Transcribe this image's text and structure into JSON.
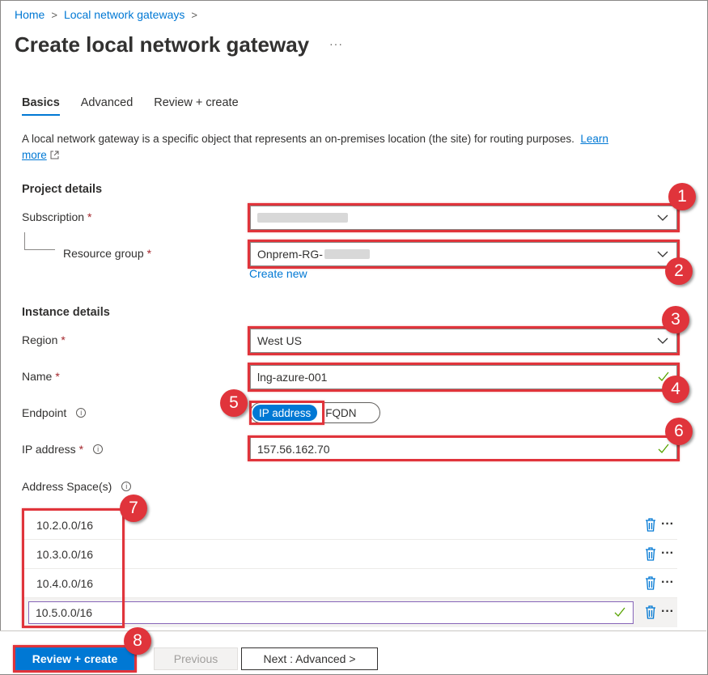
{
  "breadcrumb": {
    "home": "Home",
    "parent": "Local network gateways",
    "sep": ">"
  },
  "page_title": "Create local network gateway",
  "more_label": "···",
  "tabs": [
    {
      "label": "Basics",
      "active": true
    },
    {
      "label": "Advanced",
      "active": false
    },
    {
      "label": "Review + create",
      "active": false
    }
  ],
  "description": {
    "text": "A local network gateway is a specific object that represents an on-premises location (the site) for routing purposes.",
    "learn_more_1": "Learn",
    "learn_more_2": "more"
  },
  "project_details": {
    "heading": "Project details",
    "subscription_label": "Subscription",
    "resource_group_label": "Resource group",
    "resource_group_value": "Onprem-RG-",
    "create_new": "Create new"
  },
  "instance_details": {
    "heading": "Instance details",
    "region_label": "Region",
    "region_value": "West US",
    "name_label": "Name",
    "name_value": "lng-azure-001",
    "endpoint_label": "Endpoint",
    "endpoint_options": [
      "IP address",
      "FQDN"
    ],
    "endpoint_selected": "IP address",
    "ip_label": "IP address",
    "ip_value": "157.56.162.70",
    "address_space_label": "Address Space(s)"
  },
  "address_spaces": [
    "10.2.0.0/16",
    "10.3.0.0/16",
    "10.4.0.0/16",
    "10.5.0.0/16"
  ],
  "required_mark": "*",
  "footer": {
    "review_create": "Review + create",
    "previous": "Previous",
    "next": "Next : Advanced >"
  },
  "callouts": [
    "1",
    "2",
    "3",
    "4",
    "5",
    "6",
    "7",
    "8"
  ],
  "colors": {
    "accent": "#0078d4",
    "highlight": "#e0343b",
    "valid": "#57a300",
    "required": "#a4262c"
  },
  "icons": {
    "chevron": "chevron-down-icon",
    "check": "check-icon",
    "trash": "trash-icon",
    "info": "info-icon",
    "external": "external-link-icon"
  }
}
